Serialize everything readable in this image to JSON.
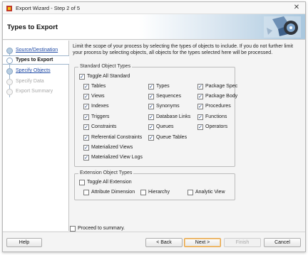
{
  "window": {
    "title": "Export Wizard - Step 2 of 5",
    "close_glyph": "✕"
  },
  "header": {
    "title": "Types to Export"
  },
  "steps": [
    {
      "label": "Source/Destination",
      "state": "link"
    },
    {
      "label": "Types to Export",
      "state": "current"
    },
    {
      "label": "Specify Objects",
      "state": "link"
    },
    {
      "label": "Specify Data",
      "state": "disabled"
    },
    {
      "label": "Export Summary",
      "state": "disabled"
    }
  ],
  "description": "Limit the scope of your process by selecting the types of objects to include.  If you do not further limit your process by selecting objects, all objects for the types selected here will be processed.",
  "standard": {
    "title": "Standard Object Types",
    "toggle_all": {
      "label": "Toggle All Standard",
      "checked": true
    },
    "items": [
      {
        "label": "Tables",
        "checked": true
      },
      {
        "label": "Views",
        "checked": true
      },
      {
        "label": "Indexes",
        "checked": true
      },
      {
        "label": "Triggers",
        "checked": true
      },
      {
        "label": "Constraints",
        "checked": true
      },
      {
        "label": "Referential Constraints",
        "checked": true
      },
      {
        "label": "Materialized Views",
        "checked": true
      },
      {
        "label": "Materialized View Logs",
        "checked": true
      },
      {
        "label": "Types",
        "checked": true
      },
      {
        "label": "Sequences",
        "checked": true
      },
      {
        "label": "Synonyms",
        "checked": true
      },
      {
        "label": "Database Links",
        "checked": true
      },
      {
        "label": "Queues",
        "checked": true
      },
      {
        "label": "Queue Tables",
        "checked": true
      },
      {
        "label": "Package Spec",
        "checked": true
      },
      {
        "label": "Package Body",
        "checked": true
      },
      {
        "label": "Procedures",
        "checked": true
      },
      {
        "label": "Functions",
        "checked": true
      },
      {
        "label": "Operators",
        "checked": true
      }
    ]
  },
  "extension": {
    "title": "Extension Object Types",
    "toggle_all": {
      "label": "Toggle All Extension",
      "checked": false
    },
    "items": [
      {
        "label": "Attribute Dimension",
        "checked": false
      },
      {
        "label": "Hierarchy",
        "checked": false
      },
      {
        "label": "Analytic View",
        "checked": false
      }
    ]
  },
  "proceed": {
    "label": "Proceed to summary.",
    "checked": false
  },
  "buttons": {
    "help": "Help",
    "back": "< Back",
    "next": "Next >",
    "finish": "Finish",
    "cancel": "Cancel"
  },
  "check_glyph": "✓"
}
